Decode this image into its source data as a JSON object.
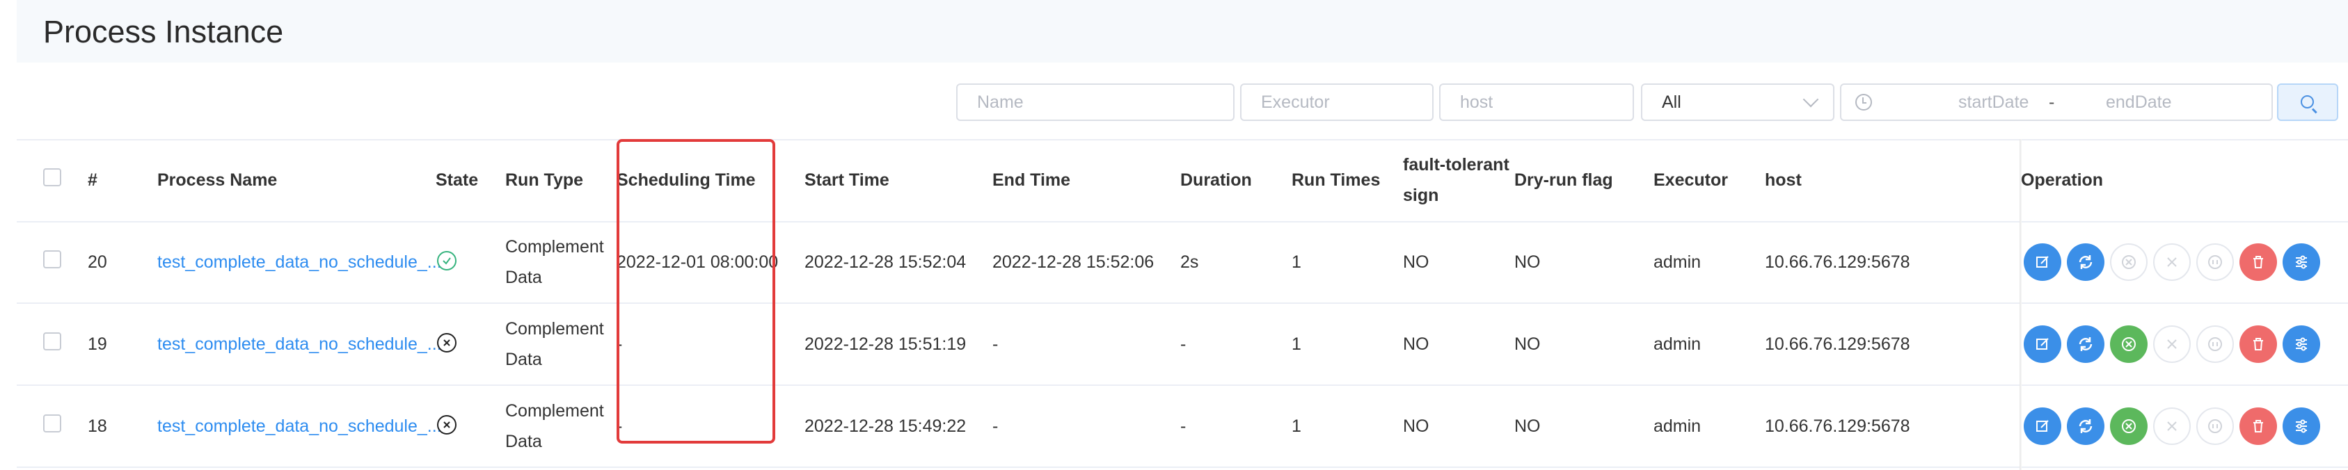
{
  "page": {
    "title": "Process Instance"
  },
  "filters": {
    "name_placeholder": "Name",
    "executor_placeholder": "Executor",
    "host_placeholder": "host",
    "state_selected": "All",
    "start_date_placeholder": "startDate",
    "date_separator": "-",
    "end_date_placeholder": "endDate"
  },
  "table": {
    "columns": {
      "index": "#",
      "process_name": "Process Name",
      "state": "State",
      "run_type": "Run Type",
      "scheduling_time": "Scheduling Time",
      "start_time": "Start Time",
      "end_time": "End Time",
      "duration": "Duration",
      "run_times": "Run Times",
      "fault_tolerant_line1": "fault-tolerant",
      "fault_tolerant_line2": "sign",
      "dry_run": "Dry-run flag",
      "executor": "Executor",
      "host": "host",
      "operation": "Operation"
    },
    "rows": [
      {
        "index": "20",
        "process_name": "test_complete_data_no_schedule_...",
        "state": "success",
        "run_type_line1": "Complement",
        "run_type_line2": "Data",
        "scheduling_time": "2022-12-01 08:00:00",
        "start_time": "2022-12-28 15:52:04",
        "end_time": "2022-12-28 15:52:06",
        "duration": "2s",
        "run_times": "1",
        "fault_tolerant": "NO",
        "dry_run": "NO",
        "executor": "admin",
        "host": "10.66.76.129:5678"
      },
      {
        "index": "19",
        "process_name": "test_complete_data_no_schedule_...",
        "state": "failure",
        "run_type_line1": "Complement",
        "run_type_line2": "Data",
        "scheduling_time": "-",
        "start_time": "2022-12-28 15:51:19",
        "end_time": "-",
        "duration": "-",
        "run_times": "1",
        "fault_tolerant": "NO",
        "dry_run": "NO",
        "executor": "admin",
        "host": "10.66.76.129:5678"
      },
      {
        "index": "18",
        "process_name": "test_complete_data_no_schedule_...",
        "state": "failure",
        "run_type_line1": "Complement",
        "run_type_line2": "Data",
        "scheduling_time": "-",
        "start_time": "2022-12-28 15:49:22",
        "end_time": "-",
        "duration": "-",
        "run_times": "1",
        "fault_tolerant": "NO",
        "dry_run": "NO",
        "executor": "admin",
        "host": "10.66.76.129:5678"
      }
    ]
  },
  "colors": {
    "primary": "#3b8fe8",
    "success": "#5cb85c",
    "danger": "#ef6b6b",
    "link": "#2d8cf0",
    "annotation": "#e23b3b"
  },
  "icons": {
    "operation_buttons": [
      "edit-icon",
      "rerun-icon",
      "recover-failed-icon",
      "stop-icon",
      "pause-icon",
      "delete-icon",
      "gantt-icon"
    ]
  }
}
